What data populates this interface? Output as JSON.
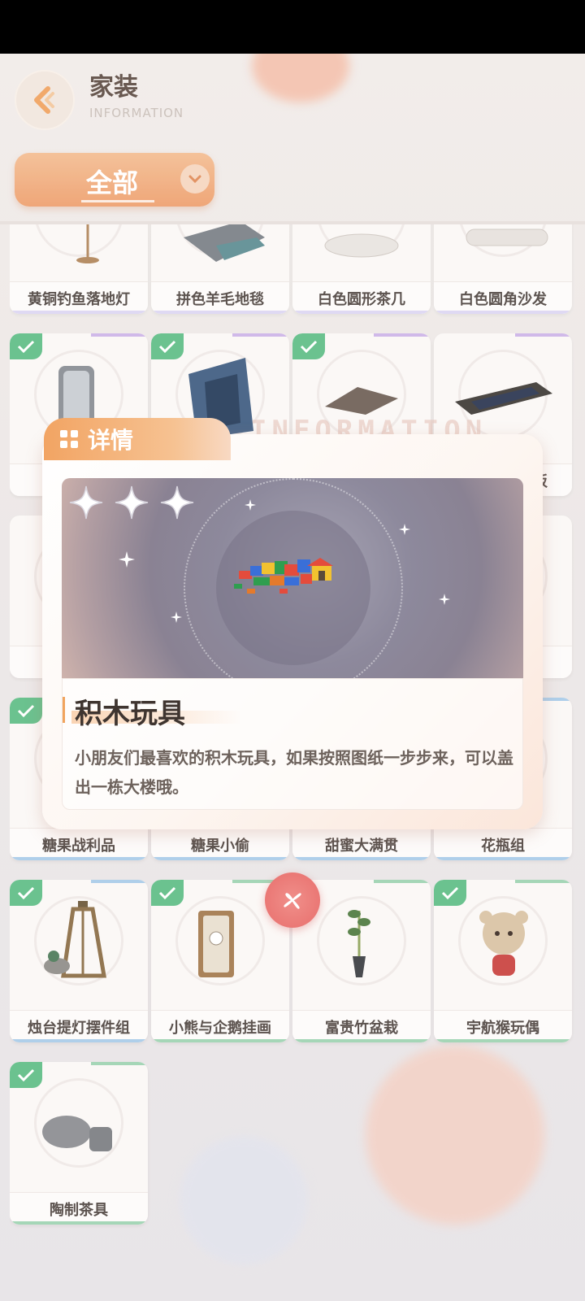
{
  "header": {
    "title": "家装",
    "subtitle": "INFORMATION",
    "back_icon": "back-arrow-icon"
  },
  "filter": {
    "label": "全部",
    "icon": "chevron-down-icon"
  },
  "grid": {
    "items": [
      {
        "label": "黄铜钓鱼落地灯",
        "owned": false
      },
      {
        "label": "拼色羊毛地毯",
        "owned": false
      },
      {
        "label": "白色圆形茶几",
        "owned": false
      },
      {
        "label": "白色圆角沙发",
        "owned": false
      },
      {
        "label": "",
        "owned": true
      },
      {
        "label": "",
        "owned": true
      },
      {
        "label": "",
        "owned": true
      },
      {
        "label": "板",
        "owned": false
      },
      {
        "label": "",
        "owned": false
      },
      {
        "label": "",
        "owned": false
      },
      {
        "label": "",
        "owned": false
      },
      {
        "label": "",
        "owned": false
      },
      {
        "label": "糖果战利品",
        "owned": true
      },
      {
        "label": "糖果小偷",
        "owned": true
      },
      {
        "label": "甜蜜大满贯",
        "owned": true
      },
      {
        "label": "花瓶组",
        "owned": true
      },
      {
        "label": "烛台提灯摆件组",
        "owned": true
      },
      {
        "label": "小熊与企鹅挂画",
        "owned": true
      },
      {
        "label": "富贵竹盆栽",
        "owned": true
      },
      {
        "label": "宇航猴玩偶",
        "owned": true
      },
      {
        "label": "陶制茶具",
        "owned": true
      }
    ]
  },
  "modal": {
    "tab_title": "详情",
    "watermark": "INFORMATION",
    "rarity_stars": 3,
    "item_name": "积木玩具",
    "item_description": "小朋友们最喜欢的积木玩具，如果按照图纸一步步来，可以盖出一栋大楼哦。",
    "close_icon": "close-icon"
  },
  "colors": {
    "accent": "#ee9f6d",
    "check": "#5fbd86",
    "close": "#e86e6c"
  }
}
